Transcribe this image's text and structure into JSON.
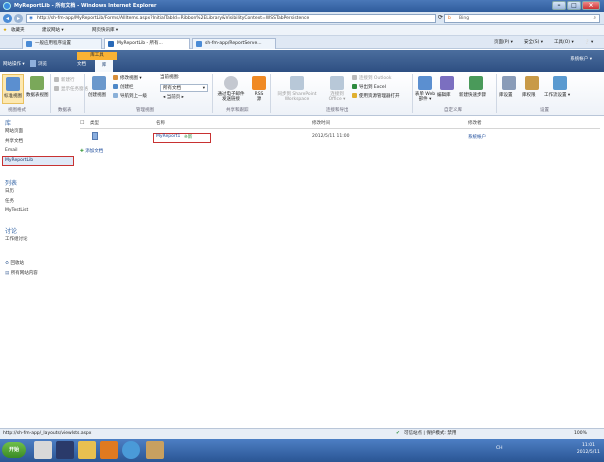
{
  "window": {
    "title": "MyReportLib - 所有文档 - Windows Internet Explorer"
  },
  "address_bar": {
    "url": "http://sh-fm-app/MyReportLib/Forms/AllItems.aspx?InitialTabId=Ribbon%2ELibrary&VisibilityContext=WSSTabPersistence",
    "search_placeholder": "Bing"
  },
  "favorites_bar": {
    "favorites_label": "收藏夹",
    "items": [
      "建议网站 ▾",
      "网页快讯库 ▾"
    ]
  },
  "tabs": [
    {
      "label": "一般应用程序设置"
    },
    {
      "label": "MyReportLib - 所有..."
    },
    {
      "label": "sh-fm-app/ReportServe..."
    }
  ],
  "command_bar": {
    "page": "页面(P) ▾",
    "safety": "安全(S) ▾",
    "tools": "工具(O) ▾",
    "help": "❔ ▾"
  },
  "sharepoint": {
    "site_actions": "网站操作 ▾",
    "browse": "浏览",
    "lib_tools": "库工具",
    "tab_documents": "文档",
    "tab_library": "库",
    "account": "系统帐户 ▾"
  },
  "ribbon": {
    "standard_view": "标准视图",
    "datasheet_view": "数据表视图",
    "new_row": "新建行",
    "show_taskpane": "显示任务窗格",
    "create_view": "创建视图",
    "modify_view": "修改视图 ▾",
    "create_column": "创建栏",
    "navigate_up": "导航到上一级",
    "current_view_label": "当前视图:",
    "current_view_value": "所有文档",
    "current_page": "◂ 当前页 ▸",
    "email_link": "通过电子邮件发送链接",
    "rss": "RSS 源",
    "sync_workspace": "同步到 SharePoint Workspace",
    "connect_office": "连接到 Office ▾",
    "connect_outlook": "连接到 Outlook",
    "export_excel": "导出到 Excel",
    "open_explorer": "使用资源管理器打开",
    "form_webparts": "表单 Web 部件 ▾",
    "edit_library": "编辑库",
    "new_quickstep": "新建快速步骤",
    "library_settings": "库设置",
    "library_permissions": "库权限",
    "workflow_settings": "工作流设置 ▾",
    "groups": [
      "视图格式",
      "数据表",
      "管理视图",
      "共享和跟踪",
      "连接和导出",
      "自定义库",
      "设置"
    ]
  },
  "left_nav": {
    "libraries_heading": "库",
    "libraries": [
      "网站页面",
      "共享文档",
      "Email",
      "MyReportLib"
    ],
    "lists_heading": "列表",
    "lists": [
      "日历",
      "任务",
      "MyTestList"
    ],
    "discussions_heading": "讨论",
    "discussions": [
      "工作组讨论"
    ],
    "recycle_bin": "回收站",
    "all_site_content": "所有网站内容"
  },
  "doc_list": {
    "headers": {
      "type": "类型",
      "name": "名称",
      "modified": "修改时间",
      "modified_by": "修改者"
    },
    "rows": [
      {
        "name": "MyReport1",
        "new_tag": "※新",
        "modified": "2012/5/11 11:00",
        "modified_by": "系统帐户"
      }
    ],
    "add_document": "添加文档"
  },
  "status_bar": {
    "url": "http://sh-fm-app/_layouts/viewlsts.aspx",
    "zone": "可信站点 | 保护模式: 禁用",
    "zoom": "100%"
  },
  "taskbar": {
    "start": "开始",
    "lang": "CH",
    "time": "11:01",
    "date": "2012/5/11"
  }
}
